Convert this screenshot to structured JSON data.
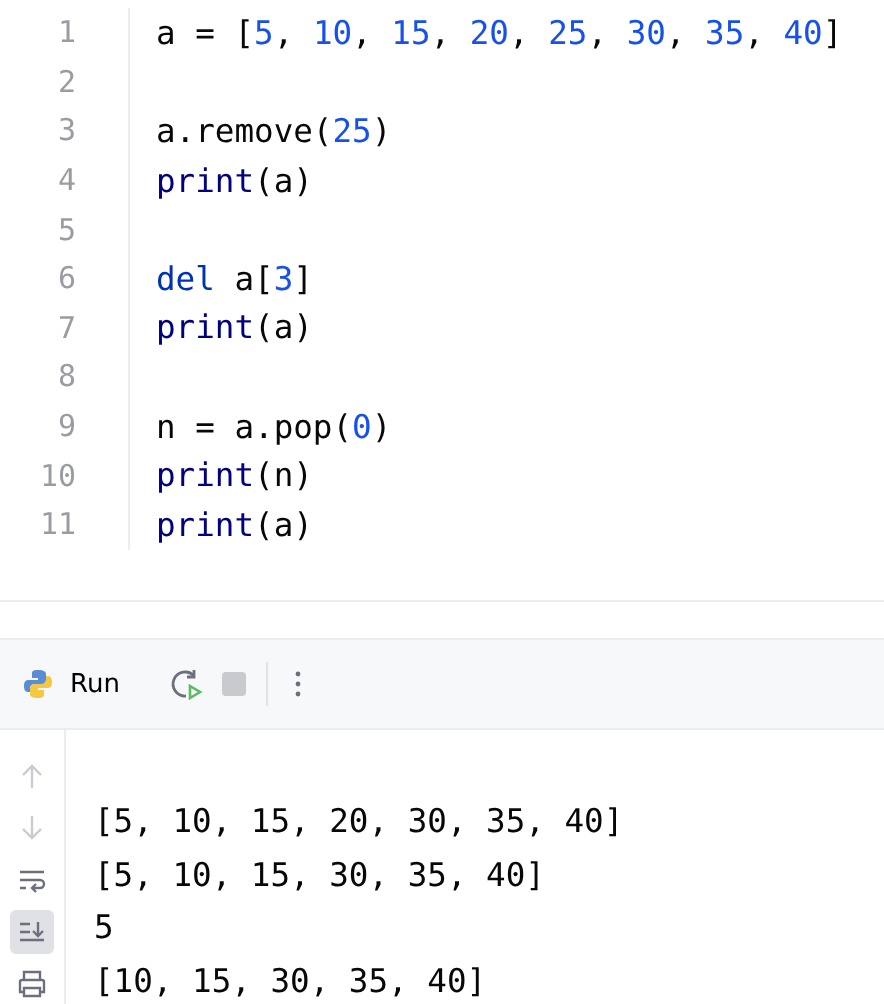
{
  "editor": {
    "lines": [
      {
        "number": "1",
        "tokens": [
          {
            "kind": "plain",
            "text": "a = ["
          },
          {
            "kind": "number",
            "text": "5"
          },
          {
            "kind": "plain",
            "text": ", "
          },
          {
            "kind": "number",
            "text": "10"
          },
          {
            "kind": "plain",
            "text": ", "
          },
          {
            "kind": "number",
            "text": "15"
          },
          {
            "kind": "plain",
            "text": ", "
          },
          {
            "kind": "number",
            "text": "20"
          },
          {
            "kind": "plain",
            "text": ", "
          },
          {
            "kind": "number",
            "text": "25"
          },
          {
            "kind": "plain",
            "text": ", "
          },
          {
            "kind": "number",
            "text": "30"
          },
          {
            "kind": "plain",
            "text": ", "
          },
          {
            "kind": "number",
            "text": "35"
          },
          {
            "kind": "plain",
            "text": ", "
          },
          {
            "kind": "number",
            "text": "40"
          },
          {
            "kind": "plain",
            "text": "]"
          }
        ]
      },
      {
        "number": "2"
      },
      {
        "number": "3",
        "tokens": [
          {
            "kind": "plain",
            "text": "a.remove("
          },
          {
            "kind": "number",
            "text": "25"
          },
          {
            "kind": "plain",
            "text": ")"
          }
        ]
      },
      {
        "number": "4",
        "tokens": [
          {
            "kind": "builtin",
            "text": "print"
          },
          {
            "kind": "plain",
            "text": "(a)"
          }
        ]
      },
      {
        "number": "5"
      },
      {
        "number": "6",
        "tokens": [
          {
            "kind": "keyword",
            "text": "del"
          },
          {
            "kind": "plain",
            "text": " a["
          },
          {
            "kind": "number",
            "text": "3"
          },
          {
            "kind": "plain",
            "text": "]"
          }
        ]
      },
      {
        "number": "7",
        "tokens": [
          {
            "kind": "builtin",
            "text": "print"
          },
          {
            "kind": "plain",
            "text": "(a)"
          }
        ]
      },
      {
        "number": "8"
      },
      {
        "number": "9",
        "tokens": [
          {
            "kind": "plain",
            "text": "n = a.pop("
          },
          {
            "kind": "number",
            "text": "0"
          },
          {
            "kind": "plain",
            "text": ")"
          }
        ]
      },
      {
        "number": "10",
        "tokens": [
          {
            "kind": "builtin",
            "text": "print"
          },
          {
            "kind": "plain",
            "text": "(n)"
          }
        ]
      },
      {
        "number": "11",
        "tokens": [
          {
            "kind": "builtin",
            "text": "print"
          },
          {
            "kind": "plain",
            "text": "(a)"
          }
        ]
      }
    ]
  },
  "run_panel": {
    "title": "Run",
    "side_tools": [
      {
        "kind": "up",
        "disabled": true,
        "selected": false
      },
      {
        "kind": "down",
        "disabled": true,
        "selected": false
      },
      {
        "kind": "wrap",
        "disabled": false,
        "selected": false
      },
      {
        "kind": "scroll-end",
        "disabled": false,
        "selected": true
      },
      {
        "kind": "print",
        "disabled": false,
        "selected": false
      }
    ],
    "output": [
      "[5, 10, 15, 20, 30, 35, 40]",
      "[5, 10, 15, 30, 35, 40]",
      "5",
      "[10, 15, 30, 35, 40]"
    ]
  }
}
